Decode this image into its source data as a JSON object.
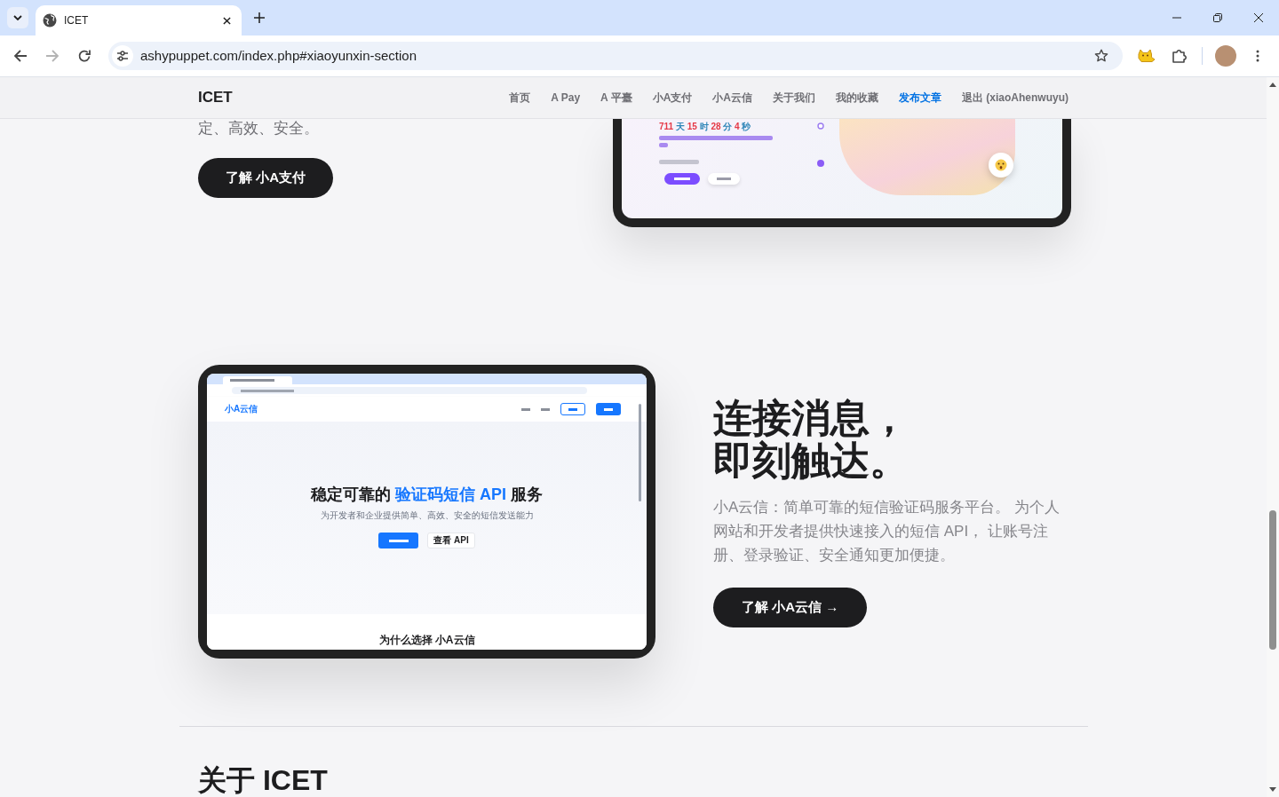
{
  "browser": {
    "tabs": [
      {
        "title": "ICET",
        "selected": true
      }
    ],
    "back": {
      "disabled": false
    },
    "forward": {
      "disabled": true
    },
    "address": "ashypuppet.com/index.php#xiaoyunxin-section"
  },
  "nav": {
    "brand": "ICET",
    "links": [
      {
        "label": "首页",
        "selected": false
      },
      {
        "label": "A Pay",
        "selected": false
      },
      {
        "label": "A 平臺",
        "selected": false
      },
      {
        "label": "小A支付",
        "selected": false
      },
      {
        "label": "小A云信",
        "selected": false
      },
      {
        "label": "关于我们",
        "selected": false
      },
      {
        "label": "我的收藏",
        "selected": false
      },
      {
        "label": "发布文章",
        "selected": true
      },
      {
        "label": "退出 (xiaoAhenwuyu)",
        "selected": false
      }
    ]
  },
  "pay_section": {
    "text": "定、高效、安全。",
    "button": "了解 小A支付",
    "screen": {
      "countdown": [
        {
          "number": "711",
          "unit": "天"
        },
        {
          "number": "15",
          "unit": "时"
        },
        {
          "number": "28",
          "unit": "分"
        },
        {
          "number": "4",
          "unit": "秒"
        }
      ]
    }
  },
  "yunxin_section": {
    "title": [
      "连接消息，",
      "即刻触达。"
    ],
    "description": "小A云信：简单可靠的短信验证码服务平台。 为个人网站和开发者提供快速接入的短信 API， 让账号注册、登录验证、安全通知更加便捷。",
    "button": "了解 小A云信 →",
    "screen": {
      "logo": "小A云信",
      "headline": [
        {
          "text": "稳定可靠的 ",
          "highlight": false
        },
        {
          "text": "验证码短信 API",
          "highlight": true
        },
        {
          "text": " 服务",
          "highlight": false
        }
      ],
      "subtitle": "为开发者和企业提供简单、高效、安全的短信发送能力",
      "secondary_button": "查看 API",
      "next_heading": "为什么选择 小A云信"
    }
  },
  "about": {
    "title": "关于 ICET"
  }
}
